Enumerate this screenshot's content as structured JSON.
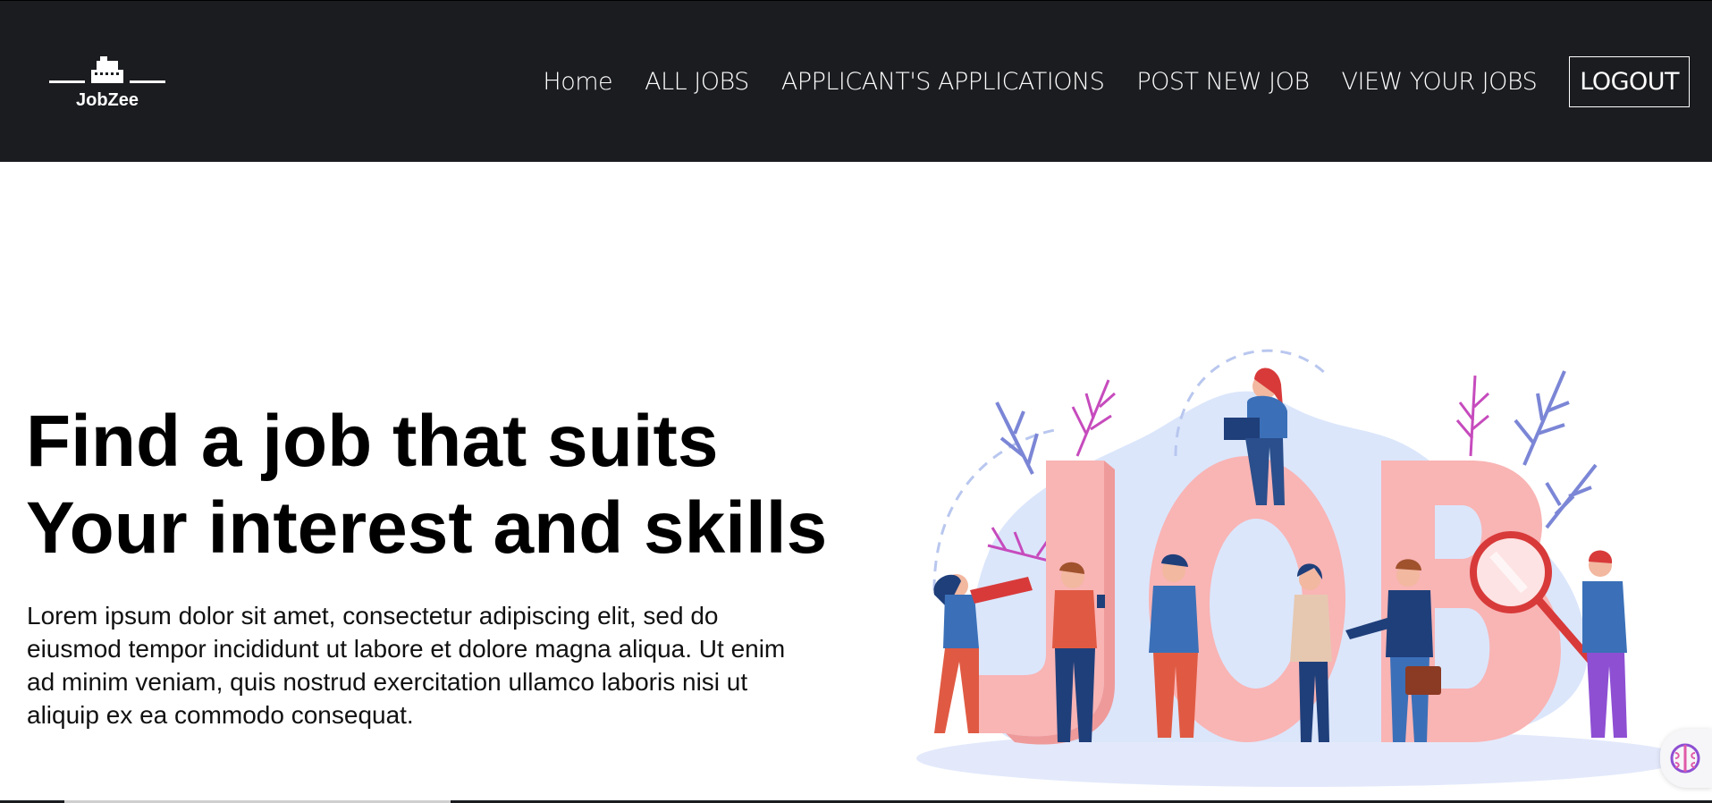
{
  "brand": {
    "name": "JobZee"
  },
  "nav": {
    "items": [
      {
        "label": "Home"
      },
      {
        "label": "ALL JOBS"
      },
      {
        "label": "APPLICANT'S APPLICATIONS"
      },
      {
        "label": "POST NEW JOB"
      },
      {
        "label": "VIEW YOUR JOBS"
      }
    ],
    "logout_label": "LOGOUT"
  },
  "hero": {
    "title_line1": "Find a job that suits",
    "title_line2": "Your interest and skills",
    "description": "Lorem ipsum dolor sit amet, consectetur adipiscing elit, sed do eiusmod tempor incididunt ut labore et dolore magna aliqua. Ut enim ad minim veniam, quis nostrud exercitation ullamco laboris nisi ut aliquip ex ea commodo consequat.",
    "illustration_letters": "JOB"
  },
  "colors": {
    "navbar_bg": "#1b1c20",
    "job_letters": "#f9b4b4",
    "leaf_blue": "#7b86d6",
    "leaf_pink": "#c64bbd",
    "blob_blue": "#dbe6fb"
  },
  "icons": {
    "logo": "typewriter-icon",
    "assistant": "brain-icon"
  }
}
